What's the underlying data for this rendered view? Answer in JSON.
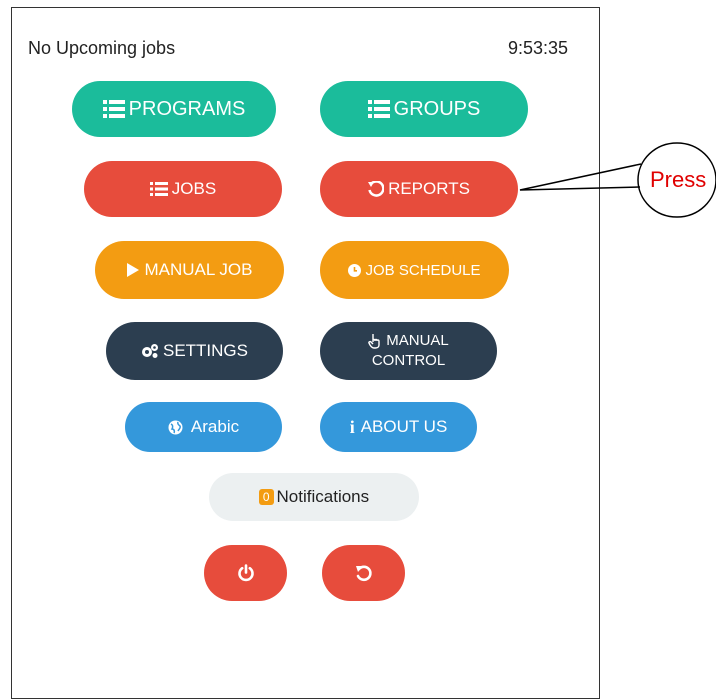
{
  "status": {
    "left": "No Upcoming jobs",
    "time": "9:53:35"
  },
  "buttons": {
    "programs": "PROGRAMS",
    "groups": "GROUPS",
    "jobs": "JOBS",
    "reports": "REPORTS",
    "manual_job": "MANUAL JOB",
    "job_schedule": "JOB SCHEDULE",
    "settings": "SETTINGS",
    "manual_control_line1": "MANUAL",
    "manual_control_line2": "CONTROL",
    "arabic": "Arabic",
    "about_us": "ABOUT US",
    "notifications": "Notifications",
    "notifications_count": "0"
  },
  "callout": {
    "text": "Press"
  },
  "colors": {
    "teal": "#1bbc9b",
    "red": "#e74c3c",
    "orange": "#f39c12",
    "navy": "#2c3e50",
    "blue": "#3498db",
    "light": "#ecf0f1",
    "callout_text": "#e00000"
  }
}
